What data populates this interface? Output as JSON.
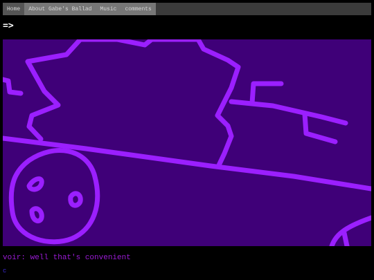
{
  "nav": {
    "items": [
      {
        "label": "Home"
      },
      {
        "label": "About Gabe's Ballad"
      },
      {
        "label": "Music"
      },
      {
        "label": "comments"
      }
    ]
  },
  "arrow_link": "=>",
  "caption": "voir: well that's convenient",
  "small_link": "c",
  "colors": {
    "panel_bg": "#3f0078",
    "stroke": "#9b1fff",
    "caption": "#9b1bd6",
    "nav_bg": "#777777"
  }
}
